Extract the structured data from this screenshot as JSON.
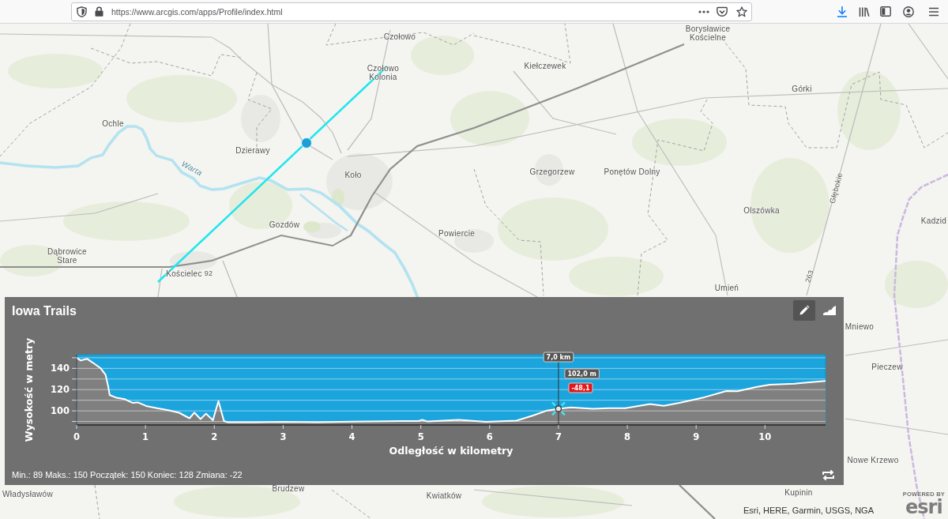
{
  "browser": {
    "url": "https://www.arcgis.com/apps/Profile/index.html"
  },
  "map": {
    "labels": [
      {
        "kind": "place",
        "text": "Czołowo"
      },
      {
        "kind": "place",
        "text": "Borysławice Kościelne"
      },
      {
        "kind": "place",
        "text": "Czołowo Kolonia"
      },
      {
        "kind": "place",
        "text": "Kiełczewek"
      },
      {
        "kind": "place",
        "text": "Górki"
      },
      {
        "kind": "place",
        "text": "Ochle"
      },
      {
        "kind": "place",
        "text": "Dzierawy"
      },
      {
        "kind": "river",
        "text": "Warta"
      },
      {
        "kind": "place",
        "text": "Koło"
      },
      {
        "kind": "place",
        "text": "Grzegorzew"
      },
      {
        "kind": "place",
        "text": "Ponętów Dolny"
      },
      {
        "kind": "street",
        "text": "Głębokie"
      },
      {
        "kind": "place",
        "text": "Olszówka"
      },
      {
        "kind": "place",
        "text": "Gozdów"
      },
      {
        "kind": "place",
        "text": "Kadzid"
      },
      {
        "kind": "place",
        "text": "Powiercie"
      },
      {
        "kind": "place",
        "text": "Dąbrowice Stare"
      },
      {
        "kind": "place",
        "text": "Kościelec"
      },
      {
        "kind": "road",
        "text": "92"
      },
      {
        "kind": "road",
        "text": "263"
      },
      {
        "kind": "place",
        "text": "Umień"
      },
      {
        "kind": "place",
        "text": "Mniewo"
      },
      {
        "kind": "place",
        "text": "Pieczew"
      },
      {
        "kind": "place",
        "text": "Nowe Krzewo"
      },
      {
        "kind": "place",
        "text": "Władysławów"
      },
      {
        "kind": "place",
        "text": "Brudzew"
      },
      {
        "kind": "place",
        "text": "Kwiatków"
      },
      {
        "kind": "place",
        "text": "Kupinin"
      }
    ],
    "attribution": "Esri, HERE, Garmin, USGS, NGA",
    "logo": {
      "tagline": "POWERED BY",
      "name": "esri"
    }
  },
  "profile_panel": {
    "title": "Iowa Trails",
    "toolbar": [
      {
        "kind": "edit",
        "selected": true
      },
      {
        "kind": "profile",
        "selected": false
      }
    ],
    "chart_data": {
      "type": "area",
      "xlabel": "Odległość w kilometry",
      "ylabel": "Wysokość w metry",
      "x": [
        0,
        0.06,
        0.15,
        0.23,
        0.35,
        0.42,
        0.46,
        0.48,
        0.58,
        0.7,
        0.81,
        0.89,
        1.01,
        1.17,
        1.33,
        1.49,
        1.64,
        1.71,
        1.8,
        1.88,
        1.98,
        2.06,
        2.14,
        2.2,
        2.6,
        3.0,
        3.5,
        4.0,
        4.5,
        4.97,
        5.02,
        5.1,
        5.55,
        5.95,
        6.39,
        6.63,
        6.82,
        7.0,
        7.18,
        7.5,
        7.73,
        7.97,
        8.33,
        8.53,
        8.77,
        9.12,
        9.44,
        9.6,
        9.87,
        10.07,
        10.43,
        10.88
      ],
      "values": [
        150,
        147.4,
        149,
        145.6,
        140,
        134,
        122.5,
        115,
        112.3,
        111,
        107.6,
        108,
        104.6,
        102.5,
        100.7,
        98.2,
        93,
        98.4,
        92.3,
        97.4,
        91.2,
        109.2,
        90.4,
        89.2,
        89.2,
        89.6,
        89.3,
        89.8,
        90.2,
        90.5,
        91.5,
        90,
        91.5,
        89.7,
        90.8,
        95.6,
        100,
        102,
        103.3,
        102,
        102.5,
        102.5,
        106.4,
        104.7,
        107.7,
        112.8,
        118.7,
        118.5,
        122.5,
        124.6,
        125.6,
        128.2
      ],
      "xlim": [
        0,
        10.88
      ],
      "ylim": [
        86.7,
        152.9
      ],
      "xticks": [
        0,
        1,
        2,
        3,
        4,
        5,
        6,
        7,
        8,
        9,
        10
      ],
      "yticks": [
        100,
        120,
        140
      ],
      "grid": true,
      "ref_lines": [
        {
          "axis": "x",
          "value": 7,
          "label": "7,0 km"
        }
      ],
      "annotations": [
        "102,0 m",
        "-48,1"
      ]
    },
    "stats": "Min.: 89 Maks.: 150 Początek: 150 Koniec: 128 Zmiana: -22"
  }
}
